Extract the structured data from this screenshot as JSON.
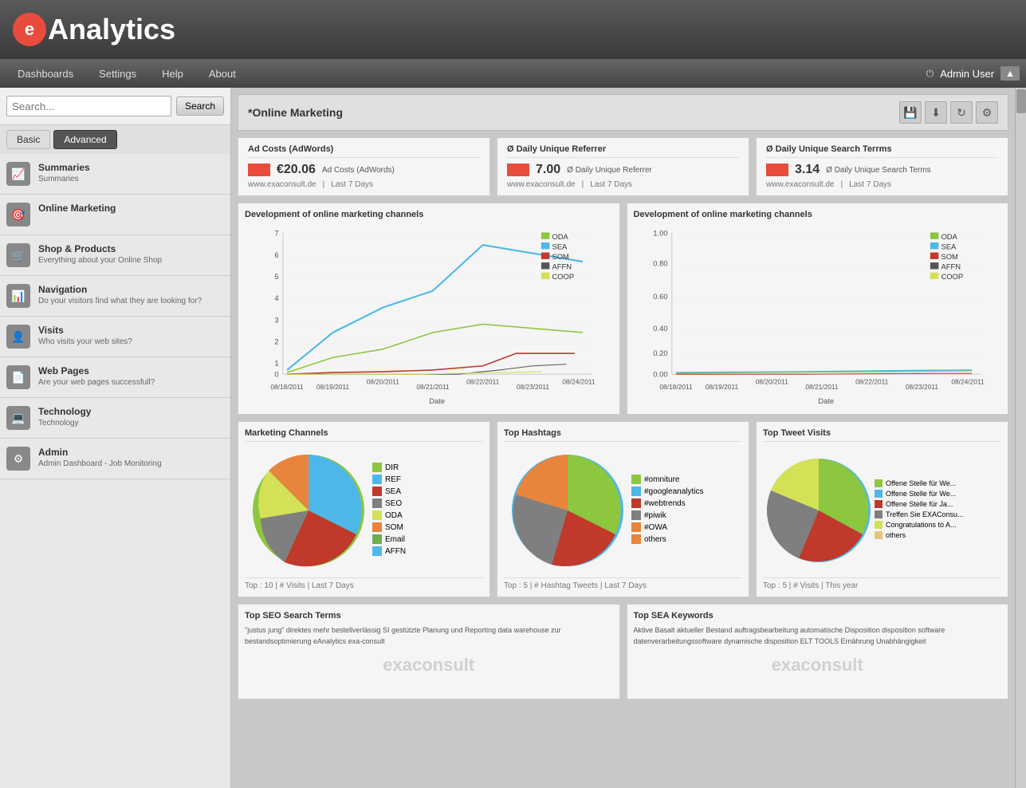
{
  "app": {
    "logo_letter": "e",
    "title": "Analytics"
  },
  "navbar": {
    "items": [
      "Dashboards",
      "Settings",
      "Help",
      "About"
    ],
    "admin_label": "Admin User"
  },
  "sidebar": {
    "search_placeholder": "Search...",
    "search_button": "Search",
    "tabs": [
      "Basic",
      "Advanced"
    ],
    "active_tab": "Advanced",
    "items": [
      {
        "id": "summaries",
        "icon": "📈",
        "title": "Summaries",
        "sub": "Summaries"
      },
      {
        "id": "online-marketing",
        "icon": "🎯",
        "title": "Online Marketing",
        "sub": ""
      },
      {
        "id": "shop-products",
        "icon": "🛒",
        "title": "Shop & Products",
        "sub": "Everything about your Online Shop"
      },
      {
        "id": "navigation",
        "icon": "📊",
        "title": "Navigation",
        "sub": "Do your visitors find what they are looking for?"
      },
      {
        "id": "visits",
        "icon": "👤",
        "title": "Visits",
        "sub": "Who visits your web sites?"
      },
      {
        "id": "web-pages",
        "icon": "📄",
        "title": "Web Pages",
        "sub": "Are your web pages successfull?"
      },
      {
        "id": "technology",
        "icon": "💻",
        "title": "Technology",
        "sub": "Technology"
      },
      {
        "id": "admin",
        "icon": "⚙",
        "title": "Admin",
        "sub": "Admin Dashboard - Job Monitoring"
      }
    ]
  },
  "page": {
    "title": "*Online Marketing",
    "toolbar_icons": [
      "save",
      "download",
      "refresh",
      "settings"
    ]
  },
  "kpi": [
    {
      "id": "ad-costs",
      "title": "Ad Costs (AdWords)",
      "value": "€20.06",
      "label": "Ad Costs (AdWords)",
      "site": "www.exaconsult.de",
      "period": "Last 7 Days"
    },
    {
      "id": "daily-referrer",
      "title": "Ø Daily Unique Referrer",
      "value": "7.00",
      "label": "Ø Daily Unique Referrer",
      "site": "www.exaconsult.de",
      "period": "Last 7 Days"
    },
    {
      "id": "search-terms",
      "title": "Ø Daily Unique Search Terrms",
      "value": "3.14",
      "label": "Ø Daily Unique Search Terms",
      "site": "www.exaconsult.de",
      "period": "Last 7 Days"
    }
  ],
  "charts": {
    "left_title": "Development of online marketing channels",
    "right_title": "Development of online marketing channels",
    "legend": [
      {
        "label": "ODA",
        "color": "#8dc63f"
      },
      {
        "label": "SEA",
        "color": "#4db8e8"
      },
      {
        "label": "SOM",
        "color": "#c0392b"
      },
      {
        "label": "AFFN",
        "color": "#555555"
      },
      {
        "label": "COOP",
        "color": "#d4e157"
      }
    ],
    "x_labels": [
      "08/18/2011",
      "08/19/2011",
      "08/20/2011",
      "08/21/2011",
      "08/22/2011",
      "08/23/2011",
      "08/24/2011"
    ],
    "y_labels_left": [
      "7",
      "6",
      "5",
      "4",
      "3",
      "2",
      "1",
      "0"
    ],
    "y_labels_right": [
      "1.00",
      "0.80",
      "0.60",
      "0.40",
      "0.20",
      "0.00"
    ],
    "x_axis_label": "Date"
  },
  "marketing_channels": {
    "title": "Marketing Channels",
    "footer": "Top : 10  |  # Visits  |  Last 7 Days",
    "legend": [
      {
        "label": "DIR",
        "color": "#8dc63f"
      },
      {
        "label": "REF",
        "color": "#4db8e8"
      },
      {
        "label": "SEA",
        "color": "#c0392b"
      },
      {
        "label": "SEO",
        "color": "#7f7f7f"
      },
      {
        "label": "ODA",
        "color": "#d4e157"
      },
      {
        "label": "SOM",
        "color": "#e8843c"
      },
      {
        "label": "Email",
        "color": "#6ab04c"
      },
      {
        "label": "AFFN",
        "color": "#4db8e8"
      }
    ]
  },
  "top_hashtags": {
    "title": "Top Hashtags",
    "footer": "Top : 5  |  # Hashtag Tweets  |  Last 7 Days",
    "legend": [
      {
        "label": "#omniture",
        "color": "#8dc63f"
      },
      {
        "label": "#googleanalytics",
        "color": "#4db8e8"
      },
      {
        "label": "#webtrends",
        "color": "#c0392b"
      },
      {
        "label": "#piwik",
        "color": "#7f7f7f"
      },
      {
        "label": "#OWA",
        "color": "#e8843c"
      },
      {
        "label": "others",
        "color": "#e8843c"
      }
    ]
  },
  "top_tweet": {
    "title": "Top Tweet Visits",
    "footer": "Top : 5  |  # Visits  |  This year",
    "legend": [
      {
        "label": "Offene Stelle für We...",
        "color": "#8dc63f"
      },
      {
        "label": "Offene Stelle für We...",
        "color": "#4db8e8"
      },
      {
        "label": "Offene Stelle für Ja...",
        "color": "#c0392b"
      },
      {
        "label": "Treffen Sie EXAConsu...",
        "color": "#7f7f7f"
      },
      {
        "label": "Congratulations to A...",
        "color": "#d4e157"
      },
      {
        "label": "others",
        "color": "#e8c57d"
      }
    ]
  },
  "seo": {
    "title": "Top SEO Search Terms",
    "content": "\"justus jung\" direktes mehr bestellverlässig SI gestützte Planung und Reporting data warehouse zur bestandsoptimierung eAnalytics exa-consult",
    "watermark": "exaconsult"
  },
  "sea": {
    "title": "Top SEA Keywords",
    "content": "Aktive Basalt aktueller Bestand auftragsbearbeitung automatische Disposition disposition software datenverarbeitungssoftware dynamische disposition ELT TOOLS Ernährung Unabhängigkeit",
    "watermark": "exaconsult"
  }
}
